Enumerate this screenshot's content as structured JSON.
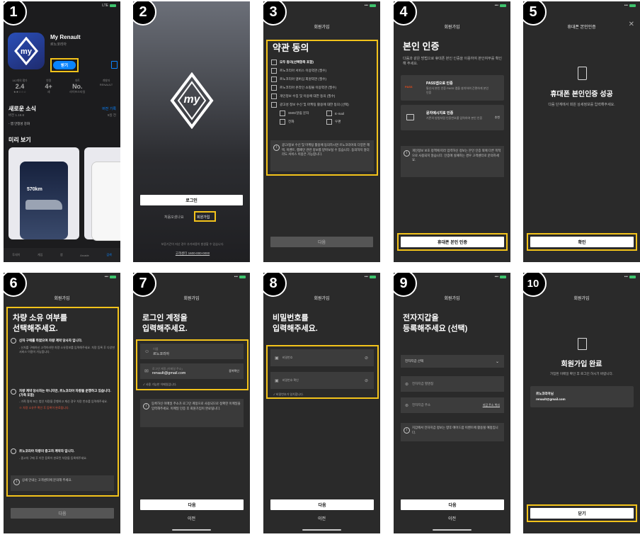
{
  "s1": {
    "step": "1",
    "app_name": "My Renault",
    "app_sub": "르노코리아",
    "get_label": "받기",
    "stats": [
      {
        "label": "142개의 평가",
        "value": "2.4",
        "sub": "★★☆☆☆"
      },
      {
        "label": "연령",
        "value": "4+",
        "sub": "세"
      },
      {
        "label": "차트",
        "value": "No.",
        "sub": "라이프스타일"
      },
      {
        "label": "개발자",
        "value": "",
        "sub": "RENAULT"
      }
    ],
    "whats_new": "새로운 소식",
    "version_history": "버전 기록",
    "version": "버전 1.19.8",
    "days_ago": "5일 전",
    "bugfix": "- 앱 안정성 강화",
    "preview": "미리 보기",
    "range_value": "570km",
    "tabs": [
      "투데이",
      "게임",
      "앱",
      "Arcade",
      "검색"
    ]
  },
  "s2": {
    "step": "2",
    "logo_text": "my",
    "login": "로그인",
    "first_time": "처음오셨나요",
    "signup": "회원가입",
    "notice": "보증기간이 지난 경우 추가비용이 발생할 수 있습니다.",
    "callcenter": "고객센터 1600-000-0000"
  },
  "s3": {
    "step": "3",
    "header": "회원가입",
    "title": "약관 동의",
    "items": [
      "모두 동의(선택항목 포함)",
      "르노코리아 서비스 이용약관 (필수)",
      "르노코리아 멤버십 회원약관 (필수)",
      "르노코리아 온라인 쇼핑몰 이용약관 (필수)",
      "개인정보 수집 및 이용에 대한 동의 (필수)",
      "광고성 정보 수신 및 마케팅 활용에 대한 동의 (선택)"
    ],
    "sub_items": [
      "SMS/알림 문자",
      "E-mail",
      "전화",
      "우편"
    ],
    "info": "광고/정보 수신 및 마케팅 활용에 동의하시면 르노코리아의 다양한 혜택, 이벤트, 캠페인 관련 정보를 받아보실 수 있습니다. 동의하지 않더라도 서비스 이용은 가능합니다.",
    "next": "다음"
  },
  "s4": {
    "step": "4",
    "header": "회원가입",
    "title": "본인 인증",
    "desc": "다음과 같은 방법으로 휴대폰 본인 인증을 이용하여 본인여부를 확인해 주세요.",
    "opt1_badge": "PASS",
    "opt1_title": "PASS앱으로 인증",
    "opt1_desc": "통신사 본인 인증 PASS 앱을 설치하여 간편하게 본인 인증",
    "opt2_title": "문자메시지로 인증",
    "opt2_desc": "기존의 방법처럼 인증번호를 입력하여 본인 인증",
    "opt2_tag": "추천",
    "info": "개인정보 보호 정책에 따라 입력하신 정보는 본인 인증 외에 다른 목적으로 사용되지 않습니다. 인증에 실패하는 경우 고객센터로 문의하세요.",
    "btn": "휴대폰 본인 인증"
  },
  "s5": {
    "step": "5",
    "header": "휴대폰 본인인증",
    "title": "휴대폰 본인인증 성공",
    "desc": "다음 단계에서 회원 상세정보를 입력해주세요.",
    "btn": "확인"
  },
  "s6": {
    "step": "6",
    "header": "회원가입",
    "title1": "차량 소유 여부를",
    "title2": "선택해주세요.",
    "opt1": "신차 구매를 하였으며 차량 계약 당사자 입니다.",
    "opt1_desc": "- 신차를 구매하신 고객이라면 차량 소유정보를 입력해주세요. 차량 등록 후 다양한 서비스 이용이 가능합니다.",
    "opt2": "차량 계약 당사자는 아니지만, 르노코리아 차량을 운행하고 있습니다. (가족 포함)",
    "opt2_desc": "- 가족 명의 또는 법인 차량을 운행하고 계신 경우 차량 번호를 입력해주세요.",
    "opt2_warn": "※ 차량 소유주 확인 후 등록이 완료됩니다.",
    "opt3": "르노코리아 차량의 중고차 계약자 입니다.",
    "opt3_desc": "- 중고차 구매 후 이전 등록이 완료된 차량을 등록해주세요.",
    "info": "상세 안내는 고객센터에 문의해 주세요.",
    "btn": "다음"
  },
  "s7": {
    "step": "7",
    "header": "회원가입",
    "title1": "로그인 계정을",
    "title2": "입력해주세요.",
    "name_label": "이름",
    "name_value": "르노코리아",
    "email_label": "로그인 계정 (이메일 주소)",
    "email_value": "renault@gmail.com",
    "dup_check": "중복확인",
    "ok_msg": "사용 가능한 이메일입니다.",
    "info": "등록하신 이메일 주소가 로그인 계정으로 사용되므로 정확한 이메일을 입력해주세요. 이메일 인증 후 회원가입이 완료됩니다.",
    "btn": "다음",
    "prev": "이전"
  },
  "s8": {
    "step": "8",
    "header": "회원가입",
    "title1": "비밀번호를",
    "title2": "입력해주세요.",
    "pw_label": "비밀번호",
    "pw2_label": "비밀번호 확인",
    "ok_msg": "비밀번호가 일치합니다.",
    "btn": "다음",
    "prev": "이전"
  },
  "s9": {
    "step": "9",
    "header": "회원가입",
    "title1": "전자지갑을",
    "title2": "등록해주세요 (선택)",
    "select": "전자지갑 선택",
    "name_ph": "전자지갑 별명칭",
    "addr_ph": "전자지갑 주소",
    "addr_link": "지갑 주소 복사",
    "info": "지갑에서 전자지갑 정보는 향후 에어드랍 이벤트에 활용될 예정입니다.",
    "btn": "다음",
    "prev": "이전"
  },
  "s10": {
    "step": "10",
    "header": "회원가입",
    "title": "회원가입 완료",
    "desc": "가입된 이메일 확인 후 로그인 하시기 바랍니다.",
    "name": "르노코리아님",
    "email": "renault@gmail.com",
    "btn": "닫기"
  }
}
